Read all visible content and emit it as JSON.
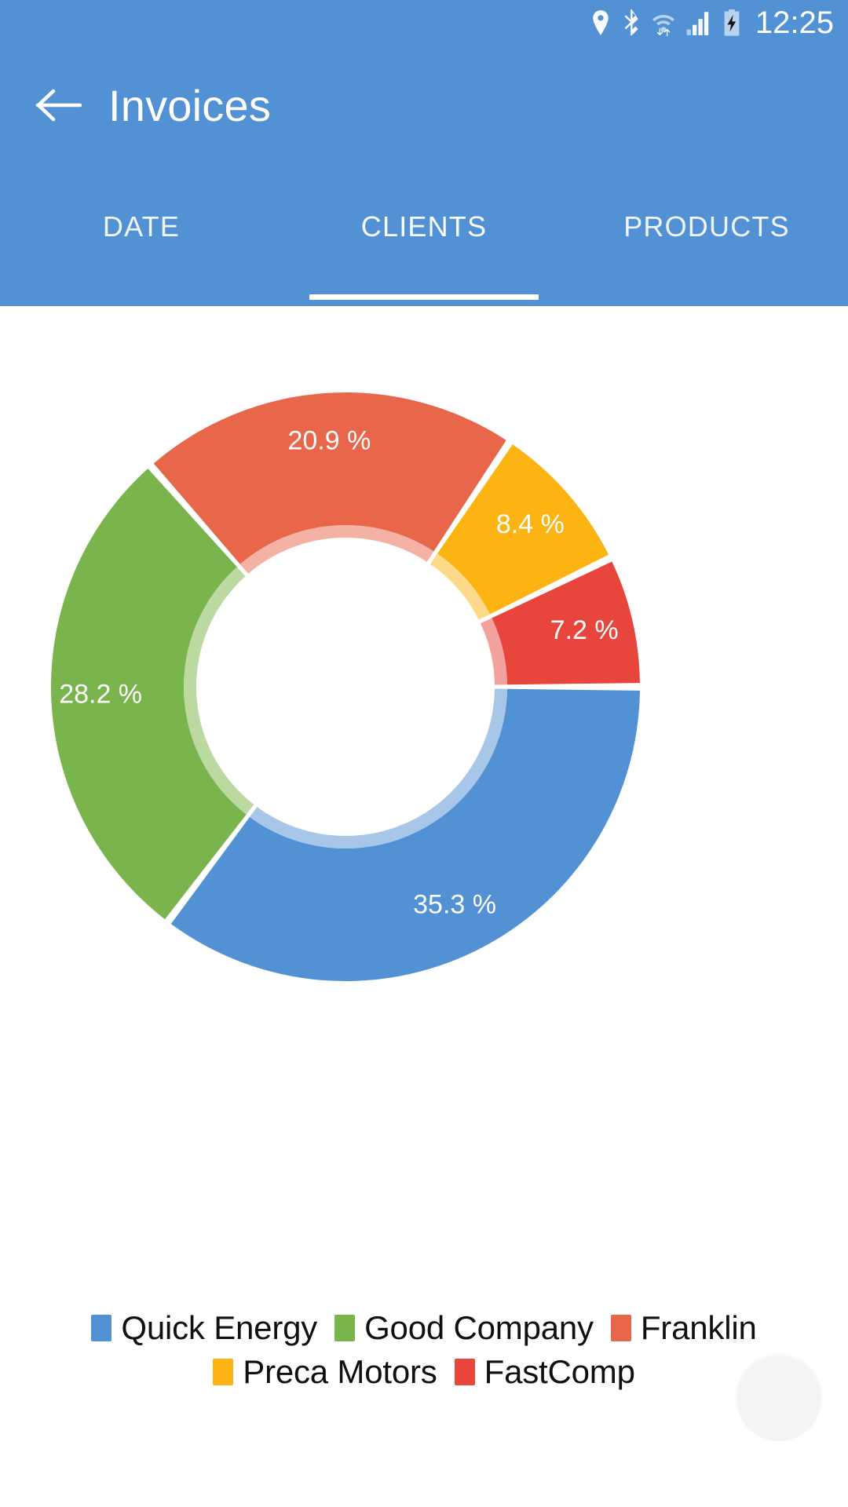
{
  "statusbar": {
    "time": "12:25",
    "icons": [
      "location-icon",
      "bluetooth-icon",
      "wifi-icon",
      "signal-icon",
      "battery-charging-icon"
    ]
  },
  "appbar": {
    "title": "Invoices",
    "back_icon": "arrow-left-icon",
    "background_color": "#5291D4"
  },
  "tabs": {
    "items": [
      {
        "label": "DATE",
        "active": false
      },
      {
        "label": "CLIENTS",
        "active": true
      },
      {
        "label": "PRODUCTS",
        "active": false
      }
    ],
    "active_index": 1,
    "indicator_color": "#FFFFFF"
  },
  "chart_data": {
    "type": "pie",
    "variant": "donut",
    "title": "",
    "legend_position": "bottom",
    "labels_on_slices": true,
    "value_suffix": " %",
    "categories": [
      "Quick Energy",
      "Good Company",
      "Franklin",
      "Preca Motors",
      "FastComp"
    ],
    "values": [
      35.3,
      28.2,
      20.9,
      8.4,
      7.2
    ],
    "data_labels": [
      "35.3 %",
      "28.2 %",
      "20.9 %",
      "8.4 %",
      "7.2 %"
    ],
    "colors": [
      "#5291D4",
      "#79B44C",
      "#E8664A",
      "#FBB412",
      "#E8453C"
    ],
    "inner_ring_colors": [
      "#A8C6E8",
      "#BCD9A2",
      "#F3B2A3",
      "#FDD98A",
      "#F3A29D"
    ],
    "slices": [
      {
        "label": "Quick Energy",
        "value": 35.3,
        "data_label": "35.3 %",
        "color": "#5291D4"
      },
      {
        "label": "Good Company",
        "value": 28.2,
        "data_label": "28.2 %",
        "color": "#79B44C"
      },
      {
        "label": "Franklin",
        "value": 20.9,
        "data_label": "20.9 %",
        "color": "#E8664A"
      },
      {
        "label": "Preca Motors",
        "value": 8.4,
        "data_label": "8.4 %",
        "color": "#FBB412"
      },
      {
        "label": "FastComp",
        "value": 7.2,
        "data_label": "7.2 %",
        "color": "#E8453C"
      }
    ]
  },
  "legend": {
    "row1": [
      {
        "label": "Quick Energy",
        "color": "#5291D4"
      },
      {
        "label": "Good Company",
        "color": "#79B44C"
      },
      {
        "label": "Franklin",
        "color": "#E8664A"
      }
    ],
    "row2": [
      {
        "label": "Preca Motors",
        "color": "#FBB412"
      },
      {
        "label": "FastComp",
        "color": "#E8453C"
      }
    ]
  }
}
